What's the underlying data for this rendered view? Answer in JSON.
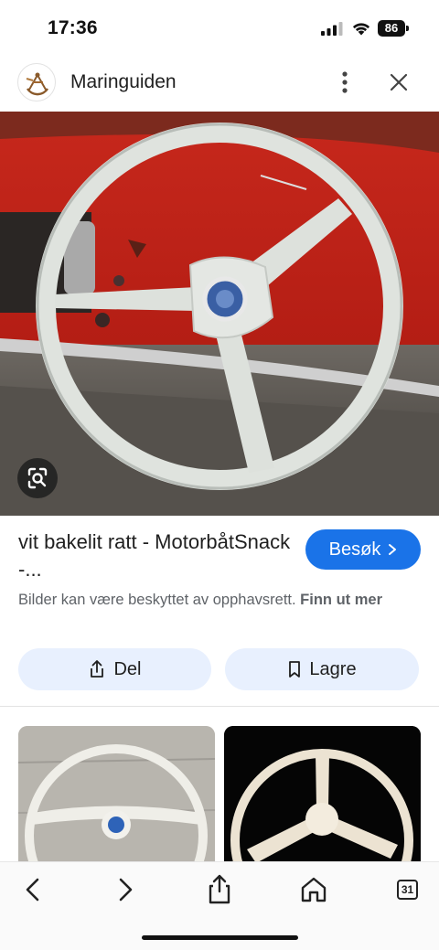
{
  "status_bar": {
    "time": "17:36",
    "battery": "86"
  },
  "header": {
    "site_name": "Maringuiden",
    "logo_icon": "sextant-logo-icon",
    "more_icon": "more-vert-icon",
    "close_icon": "close-icon"
  },
  "result": {
    "title": "vit bakelit ratt - MotorbåtSnack -...",
    "visit_label": "Besøk",
    "copyright_text": "Bilder kan være beskyttet av opphavsrett.",
    "learn_more": "Finn ut mer",
    "share_label": "Del",
    "save_label": "Lagre"
  },
  "toolbar": {
    "tabs_count": "31",
    "icons": [
      "back-icon",
      "forward-icon",
      "share-icon",
      "home-icon",
      "tabs-icon"
    ]
  },
  "colors": {
    "accent": "#1a73e8",
    "chip_bg": "#e8f0fe",
    "secondary_text": "#5f6368"
  }
}
